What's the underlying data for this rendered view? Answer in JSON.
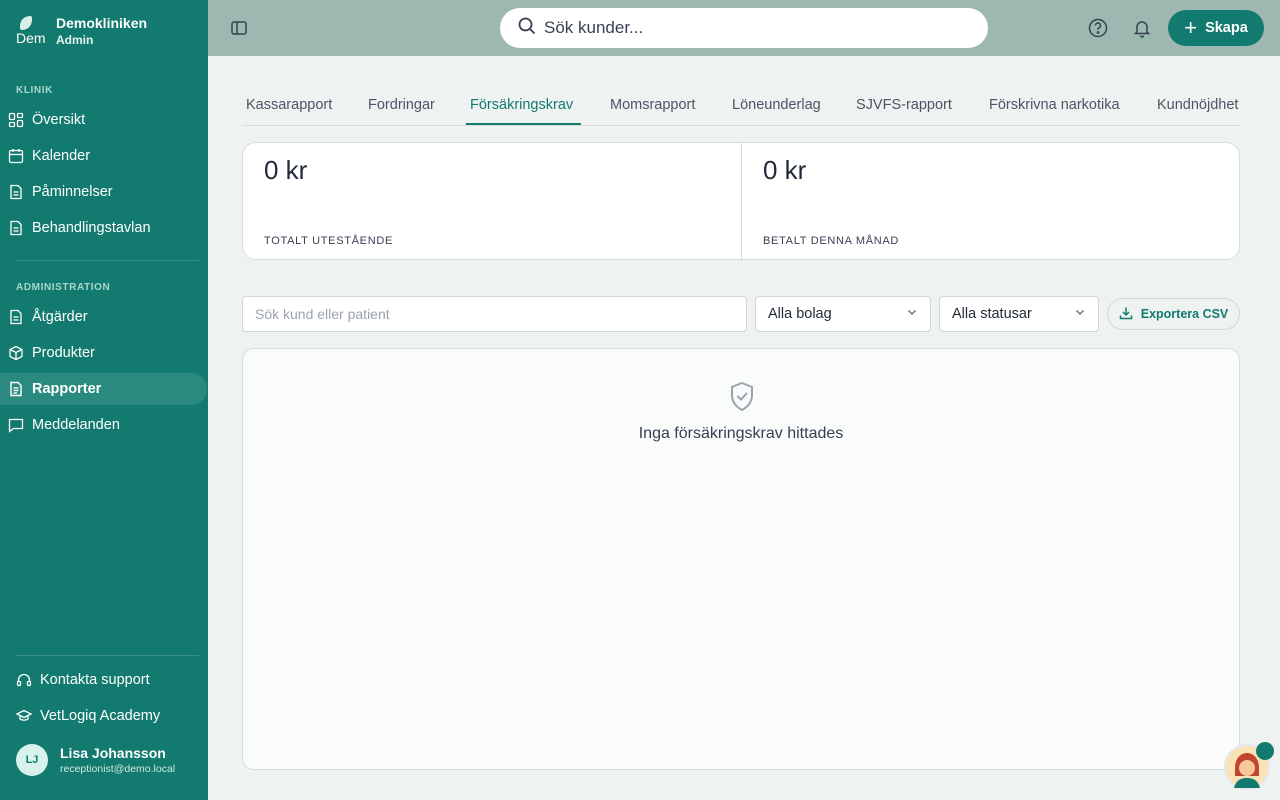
{
  "brand": {
    "name": "Demokliniken",
    "role": "Admin",
    "logo_text": "Dem"
  },
  "sidebar": {
    "section_klinik": "KLINIK",
    "klinik_items": [
      {
        "label": "Översikt",
        "icon": "grid-icon"
      },
      {
        "label": "Kalender",
        "icon": "calendar-icon"
      },
      {
        "label": "Påminnelser",
        "icon": "document-icon"
      },
      {
        "label": "Behandlingstavlan",
        "icon": "document-icon"
      }
    ],
    "section_admin": "ADMINISTRATION",
    "admin_items": [
      {
        "label": "Åtgärder",
        "icon": "document-icon"
      },
      {
        "label": "Produkter",
        "icon": "box-icon"
      },
      {
        "label": "Rapporter",
        "icon": "report-icon",
        "active": true
      },
      {
        "label": "Meddelanden",
        "icon": "chat-icon"
      }
    ],
    "footer_items": [
      {
        "label": "Kontakta support",
        "icon": "headset-icon"
      },
      {
        "label": "VetLogiq Academy",
        "icon": "graduation-cap-icon"
      }
    ],
    "user": {
      "initials": "LJ",
      "name": "Lisa Johansson",
      "email": "receptionist@demo.local"
    }
  },
  "topbar": {
    "search_placeholder": "Sök kunder...",
    "create_label": "Skapa"
  },
  "tabs": [
    "Kassarapport",
    "Fordringar",
    "Försäkringskrav",
    "Momsrapport",
    "Löneunderlag",
    "SJVFS-rapport",
    "Förskrivna narkotika",
    "Kundnöjdhet"
  ],
  "active_tab": "Försäkringskrav",
  "stats": [
    {
      "value": "0 kr",
      "label": "TOTALT UTESTÅENDE"
    },
    {
      "value": "0 kr",
      "label": "BETALT DENNA MÅNAD"
    }
  ],
  "filters": {
    "search_placeholder": "Sök kund eller patient",
    "company_select": "Alla bolag",
    "status_select": "Alla statusar",
    "export_label": "Exportera CSV"
  },
  "empty_state": {
    "message": "Inga försäkringskrav hittades",
    "icon": "shield-check-icon"
  },
  "colors": {
    "primary": "#127a6e",
    "topbar": "#9db7b1",
    "background": "#eef3f2"
  }
}
